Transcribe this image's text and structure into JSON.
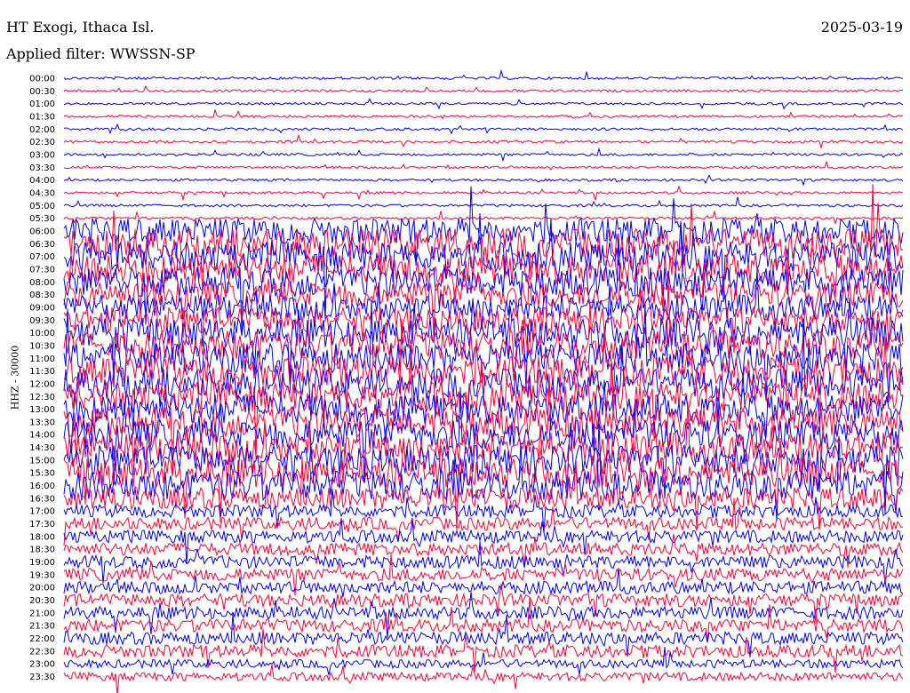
{
  "header": {
    "station": "HT Exogi, Ithaca Isl.",
    "date": "2025-03-19",
    "filter": "Applied filter: WWSSN-SP"
  },
  "colors": {
    "blue": "#0000ff",
    "red": "#ff0033"
  },
  "chart_data": {
    "type": "line",
    "title": "HT Exogi, Ithaca Isl.",
    "ylabel": "HHZ - 30000",
    "yticks": [
      "00:00",
      "00:30",
      "01:00",
      "01:30",
      "02:00",
      "02:30",
      "03:00",
      "03:30",
      "04:00",
      "04:30",
      "05:00",
      "05:30",
      "06:00",
      "06:30",
      "07:00",
      "07:30",
      "08:00",
      "08:30",
      "09:00",
      "09:30",
      "10:00",
      "10:30",
      "11:00",
      "11:30",
      "12:00",
      "12:30",
      "13:00",
      "13:30",
      "14:00",
      "14:30",
      "15:00",
      "15:30",
      "16:00",
      "16:30",
      "17:00",
      "17:30",
      "18:00",
      "18:30",
      "19:00",
      "19:30",
      "20:00",
      "20:30",
      "21:00",
      "21:30",
      "22:00",
      "22:30",
      "23:00",
      "23:30"
    ],
    "trace_colors": [
      "blue",
      "red"
    ],
    "activity": [
      1,
      1,
      1,
      1,
      1,
      1,
      1,
      1,
      1,
      1,
      1,
      1,
      6,
      7,
      7,
      7,
      7,
      6,
      6,
      6,
      7,
      7,
      7,
      7,
      7,
      7,
      7,
      7,
      7,
      7,
      7,
      7,
      7,
      5,
      3,
      3,
      3,
      3,
      3,
      3,
      3,
      3,
      3,
      3,
      3,
      3,
      2,
      2
    ],
    "grid": false,
    "legend": "none"
  }
}
